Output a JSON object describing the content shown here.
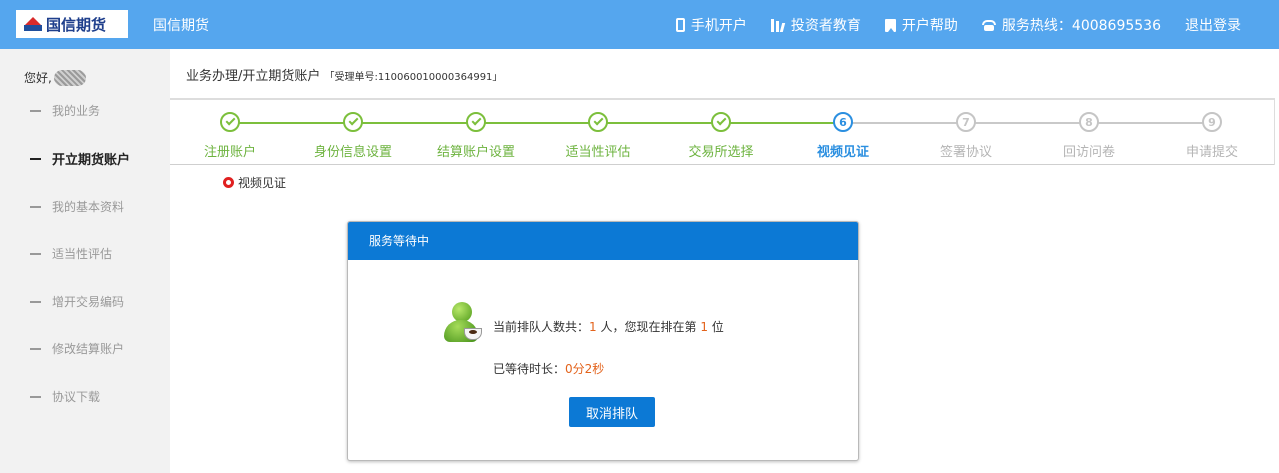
{
  "header": {
    "logo_text": "国信期货",
    "app_name": "国信期货",
    "links": [
      {
        "label": "手机开户",
        "icon": "phone-icon"
      },
      {
        "label": "投资者教育",
        "icon": "books-icon"
      },
      {
        "label": "开户帮助",
        "icon": "help-book-icon"
      },
      {
        "label": "服务热线：4008695536",
        "icon": "telephone-icon"
      },
      {
        "label": "退出登录",
        "icon": ""
      }
    ],
    "bg_color": "#55a6ee"
  },
  "sidebar": {
    "greeting": "您好,",
    "items": [
      {
        "label": "我的业务",
        "active": false
      },
      {
        "label": "开立期货账户",
        "active": true
      },
      {
        "label": "我的基本资料",
        "active": false
      },
      {
        "label": "适当性评估",
        "active": false
      },
      {
        "label": "增开交易编码",
        "active": false
      },
      {
        "label": "修改结算账户",
        "active": false
      },
      {
        "label": "协议下载",
        "active": false
      }
    ]
  },
  "breadcrumb": {
    "path": "业务办理/开立期货账户",
    "ticket": "「受理单号:110060010000364991」"
  },
  "steps": [
    {
      "label": "注册账户",
      "num": "1",
      "state": "done"
    },
    {
      "label": "身份信息设置",
      "num": "2",
      "state": "done"
    },
    {
      "label": "结算账户设置",
      "num": "3",
      "state": "done"
    },
    {
      "label": "适当性评估",
      "num": "4",
      "state": "done"
    },
    {
      "label": "交易所选择",
      "num": "5",
      "state": "done"
    },
    {
      "label": "视频见证",
      "num": "6",
      "state": "current"
    },
    {
      "label": "签署协议",
      "num": "7",
      "state": "todo"
    },
    {
      "label": "回访问卷",
      "num": "8",
      "state": "todo"
    },
    {
      "label": "申请提交",
      "num": "9",
      "state": "todo"
    }
  ],
  "section_title": "视频见证",
  "modal": {
    "title": "服务等待中",
    "queue_prefix": "当前排队人数共：",
    "queue_count": "1",
    "queue_mid": "人，您现在排在第",
    "queue_position": "1",
    "queue_suffix": "位",
    "wait_prefix": "已等待时长：",
    "wait_time": "0分2秒",
    "cancel_label": "取消排队"
  },
  "colors": {
    "done": "#6db33f",
    "current": "#2b8fe0",
    "todo": "#c5c5c5",
    "modal_header": "#0c79d5",
    "highlight": "#e3631c"
  }
}
